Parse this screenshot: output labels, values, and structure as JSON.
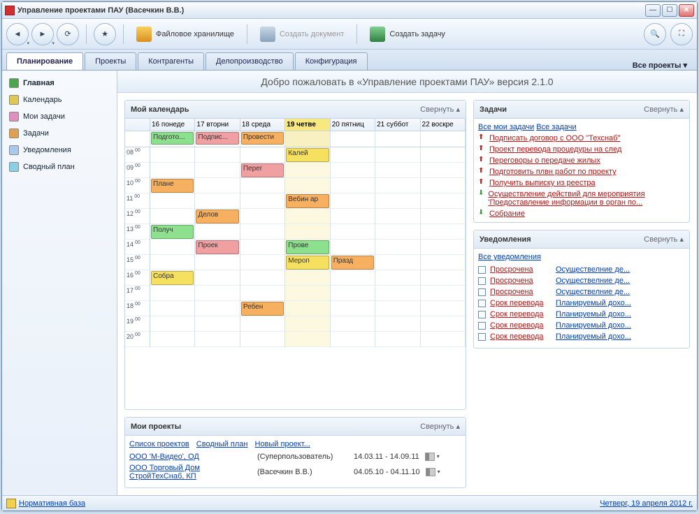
{
  "titlebar": {
    "text": "Управление проектами ПАУ (Васечкин В.В.)"
  },
  "toolbar": {
    "file_storage": "Файловое хранилище",
    "create_doc": "Создать документ",
    "create_task": "Создать задачу"
  },
  "tabs": {
    "items": [
      "Планирование",
      "Проекты",
      "Контрагенты",
      "Делопроизводство",
      "Конфигурация"
    ],
    "right": "Все проекты ▾"
  },
  "welcome": "Добро пожаловать в «Управление проектами ПАУ» версия 2.1.0",
  "sidebar": {
    "items": [
      "Главная",
      "Календарь",
      "Мои задачи",
      "Задачи",
      "Уведомления",
      "Сводный план"
    ]
  },
  "calendar": {
    "title": "Мой календарь",
    "collapse": "Свернуть ▴",
    "days": [
      "16 понеде",
      "17 вторни",
      "18 среда",
      "19 четве",
      "20 пятниц",
      "21 суббот",
      "22 воскре"
    ],
    "allday": [
      {
        "day": 0,
        "color": "green",
        "label": "Подгото..."
      },
      {
        "day": 1,
        "color": "red",
        "label": "Подпис..."
      },
      {
        "day": 2,
        "color": "orange",
        "label": "Провести"
      }
    ],
    "hours": [
      "08",
      "09",
      "10",
      "11",
      "12",
      "13",
      "14",
      "15",
      "16",
      "17",
      "18",
      "19",
      "20"
    ],
    "events": [
      {
        "day": 3,
        "slot": 0,
        "color": "yellow",
        "label": "Калей"
      },
      {
        "day": 2,
        "slot": 1,
        "color": "red",
        "label": "Перег"
      },
      {
        "day": 0,
        "slot": 2,
        "color": "orange",
        "label": "Плане"
      },
      {
        "day": 3,
        "slot": 3,
        "color": "orange",
        "label": "Вебин ар"
      },
      {
        "day": 1,
        "slot": 4,
        "color": "orange",
        "label": "Делов"
      },
      {
        "day": 0,
        "slot": 5,
        "color": "green",
        "label": "Получ"
      },
      {
        "day": 1,
        "slot": 6,
        "color": "red",
        "label": "Проек"
      },
      {
        "day": 3,
        "slot": 6,
        "color": "green",
        "label": "Прове"
      },
      {
        "day": 3,
        "slot": 7,
        "color": "yellow",
        "label": "Мероп"
      },
      {
        "day": 4,
        "slot": 7,
        "color": "orange",
        "label": "Празд"
      },
      {
        "day": 0,
        "slot": 8,
        "color": "yellow",
        "label": "Собра"
      },
      {
        "day": 2,
        "slot": 10,
        "color": "orange",
        "label": "Ребен"
      }
    ]
  },
  "tasks": {
    "title": "Задачи",
    "collapse": "Свернуть ▴",
    "links": [
      "Все мои задачи",
      "Все задачи"
    ],
    "items": [
      {
        "arrow": "up",
        "label": "Подписать договор с ООО \"Техснаб\""
      },
      {
        "arrow": "up",
        "label": "Проект перевода процедуры на след"
      },
      {
        "arrow": "up",
        "label": "Переговоры о передаче жилых"
      },
      {
        "arrow": "up",
        "label": "Подготовить плвн работ по проекту"
      },
      {
        "arrow": "up",
        "label": "Получить выписку из реестра"
      },
      {
        "arrow": "down",
        "label": "Осуществление действий для мероприятия 'Предоставление информации в орган по..."
      },
      {
        "arrow": "down",
        "label": "Собрание"
      }
    ]
  },
  "notifs": {
    "title": "Уведомления",
    "collapse": "Свернуть ▴",
    "all": "Все уведомления",
    "items": [
      {
        "status": "Просрочена",
        "link": "Осуществелние де..."
      },
      {
        "status": "Просрочена",
        "link": "Осуществелние де..."
      },
      {
        "status": "Просрочена",
        "link": "Осуществелние де..."
      },
      {
        "status": "Срок перевода",
        "link": "Планируемый дохо..."
      },
      {
        "status": "Срок перевода",
        "link": "Планируемый дохо..."
      },
      {
        "status": "Срок перевода",
        "link": "Планируемый дохо..."
      },
      {
        "status": "Срок перевода",
        "link": "Планируемый дохо..."
      }
    ]
  },
  "projects": {
    "title": "Мои проекты",
    "collapse": "Свернуть ▴",
    "links": [
      "Список проектов",
      "Сводный план",
      "Новый проект..."
    ],
    "rows": [
      {
        "name": "ООО 'М-Видео', ОД",
        "owner": "(Суперпользователь)",
        "dates": "14.03.11 - 14.09.11"
      },
      {
        "name": "ООО Торговый Дом СтройТехСнаб, КП",
        "owner": "(Васечкин В.В.)",
        "dates": "04.05.10 - 04.11.10"
      }
    ]
  },
  "status": {
    "left": "Нормативная база",
    "right": "Четверг, 19 апреля 2012 г."
  }
}
